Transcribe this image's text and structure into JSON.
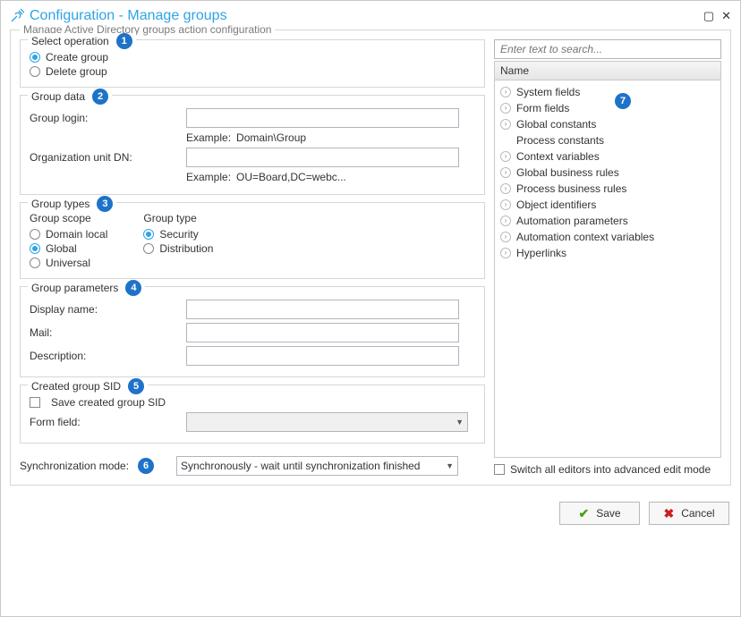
{
  "window": {
    "title": "Configuration - Manage groups"
  },
  "outer_legend": "Manage Active Directory groups action configuration",
  "select_operation": {
    "legend": "Select operation",
    "badge": "1",
    "create": "Create group",
    "delete": "Delete group"
  },
  "group_data": {
    "legend": "Group data",
    "badge": "2",
    "login_label": "Group login:",
    "example_label": "Example:",
    "login_example": "Domain\\Group",
    "ou_label": "Organization unit DN:",
    "ou_example": "OU=Board,DC=webc..."
  },
  "group_types": {
    "legend": "Group types",
    "badge": "3",
    "scope_label": "Group scope",
    "scope": {
      "domain_local": "Domain local",
      "global": "Global",
      "universal": "Universal"
    },
    "type_label": "Group type",
    "type": {
      "security": "Security",
      "distribution": "Distribution"
    }
  },
  "group_params": {
    "legend": "Group parameters",
    "badge": "4",
    "display_name": "Display name:",
    "mail": "Mail:",
    "description": "Description:"
  },
  "created_sid": {
    "legend": "Created group SID",
    "badge": "5",
    "save_checkbox": "Save created group SID",
    "form_field": "Form field:"
  },
  "sync": {
    "label": "Synchronization mode:",
    "badge": "6",
    "value": "Synchronously - wait until synchronization finished"
  },
  "right": {
    "search_placeholder": "Enter text to search...",
    "name_header": "Name",
    "badge": "7",
    "items": [
      {
        "label": "System fields",
        "exp": true
      },
      {
        "label": "Form fields",
        "exp": true
      },
      {
        "label": "Global constants",
        "exp": true
      },
      {
        "label": "Process constants",
        "exp": false
      },
      {
        "label": "Context variables",
        "exp": true
      },
      {
        "label": "Global business rules",
        "exp": true
      },
      {
        "label": "Process business rules",
        "exp": true
      },
      {
        "label": "Object identifiers",
        "exp": true
      },
      {
        "label": "Automation parameters",
        "exp": true
      },
      {
        "label": "Automation context variables",
        "exp": true
      },
      {
        "label": "Hyperlinks",
        "exp": true
      }
    ],
    "advanced": "Switch all editors into advanced edit mode"
  },
  "footer": {
    "save": "Save",
    "cancel": "Cancel"
  }
}
